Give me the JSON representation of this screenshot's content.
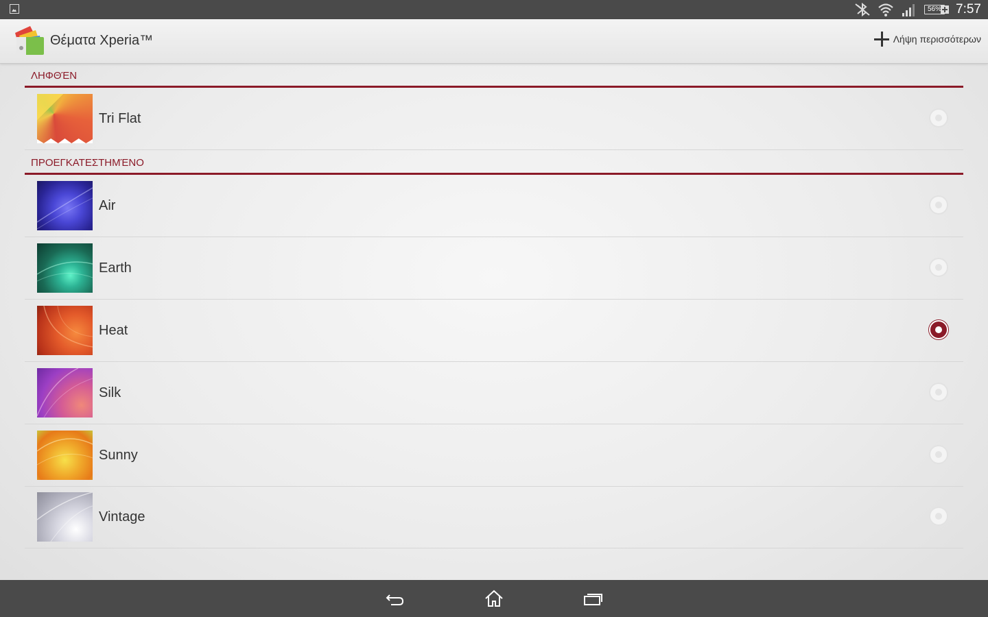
{
  "status_bar": {
    "battery_percent": "56%",
    "time": "7:57",
    "icons": [
      "gallery-notification-icon",
      "bluetooth-off-icon",
      "wifi-icon",
      "signal-icon",
      "battery-charging-icon"
    ]
  },
  "action_bar": {
    "title": "Θέματα Xperia™",
    "get_more_label": "Λήψη περισσότερων",
    "icons": [
      "xperia-themes-logo",
      "plus-icon"
    ]
  },
  "sections": [
    {
      "header": "ΛΗΦΘΈΝ",
      "items": [
        {
          "label": "Tri Flat",
          "selected": false
        }
      ]
    },
    {
      "header": "ΠΡΟΕΓΚΑΤΕΣΤΗΜΈΝΟ",
      "items": [
        {
          "label": "Air",
          "selected": false
        },
        {
          "label": "Earth",
          "selected": false
        },
        {
          "label": "Heat",
          "selected": true
        },
        {
          "label": "Silk",
          "selected": false
        },
        {
          "label": "Sunny",
          "selected": false
        },
        {
          "label": "Vintage",
          "selected": false
        }
      ]
    }
  ],
  "nav_bar": {
    "icons": [
      "back-icon",
      "home-icon",
      "recent-apps-icon"
    ]
  },
  "colors": {
    "accent": "#8b1a28",
    "bars": "#4a4a4a"
  }
}
